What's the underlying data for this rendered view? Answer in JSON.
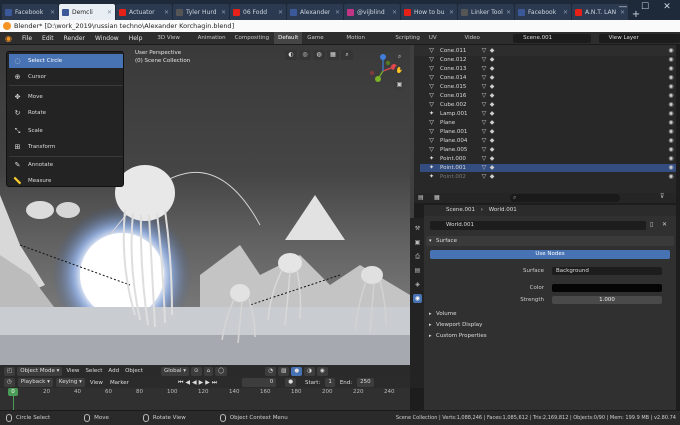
{
  "browser": {
    "tabs": [
      {
        "label": "Facebook",
        "color": "#3b5998",
        "active": false
      },
      {
        "label": "Demcli",
        "color": "#3b5998",
        "active": true
      },
      {
        "label": "Actuator",
        "color": "#e62117",
        "active": false
      },
      {
        "label": "Tyler Hurd",
        "color": "#555555",
        "active": false
      },
      {
        "label": "06 Fodd",
        "color": "#e62117",
        "active": false
      },
      {
        "label": "Alexander",
        "color": "#3b5998",
        "active": false
      },
      {
        "label": "@vijblind",
        "color": "#c13584",
        "active": false
      },
      {
        "label": "How to bu",
        "color": "#e62117",
        "active": false
      },
      {
        "label": "Linker Tools",
        "color": "#555555",
        "active": false
      },
      {
        "label": "Facebook",
        "color": "#3b5998",
        "active": false
      },
      {
        "label": "A.N.T. LAN",
        "color": "#e62117",
        "active": false
      }
    ],
    "new_tab": "+",
    "minimize": "—",
    "maximize": "☐",
    "close": "✕"
  },
  "window_title": "Blender* [D:\\work_2019\\russian techno\\Alexander Korchagin.blend]",
  "menu": [
    "File",
    "Edit",
    "Render",
    "Window",
    "Help"
  ],
  "workspaces": [
    "3D View Full",
    "Animation",
    "Compositing",
    "Default",
    "Game Logic",
    "Motion Tracking",
    "Scripting",
    "UV Editing",
    "Video Editing"
  ],
  "active_workspace": "Default",
  "scene_name": "Scene.001",
  "view_layer": "View Layer",
  "viewport": {
    "perspective": "User Perspective",
    "collection": "(0) Scene Collection"
  },
  "tools": [
    {
      "label": "Select Circle",
      "icon": "◌",
      "active": true
    },
    {
      "label": "Cursor",
      "icon": "⊕",
      "active": false
    },
    {
      "label": "Move",
      "icon": "✥",
      "active": false
    },
    {
      "label": "Rotate",
      "icon": "↻",
      "active": false
    },
    {
      "label": "Scale",
      "icon": "⤡",
      "active": false
    },
    {
      "label": "Transform",
      "icon": "⊞",
      "active": false
    },
    {
      "label": "Annotate",
      "icon": "✎",
      "active": false
    },
    {
      "label": "Measure",
      "icon": "📏",
      "active": false
    }
  ],
  "gizmo": {
    "x": "X",
    "y": "Y",
    "z": "Z"
  },
  "vp_header": {
    "mode": "Object Mode",
    "view": "View",
    "select": "Select",
    "add": "Add",
    "object": "Object",
    "orientation": "Global"
  },
  "timeline": {
    "playback": "Playback",
    "keying": "Keying",
    "view": "View",
    "marker": "Marker",
    "current": "0",
    "start_label": "Start:",
    "start": "1",
    "end_label": "End:",
    "end": "250",
    "ticks": [
      "0",
      "20",
      "40",
      "60",
      "80",
      "100",
      "120",
      "140",
      "160",
      "180",
      "200",
      "220",
      "240"
    ]
  },
  "outliner": {
    "rows": [
      {
        "name": "Cone.011",
        "icon": "▽",
        "sel": false,
        "dim": false
      },
      {
        "name": "Cone.012",
        "icon": "▽",
        "sel": false,
        "dim": false
      },
      {
        "name": "Cone.013",
        "icon": "▽",
        "sel": false,
        "dim": false
      },
      {
        "name": "Cone.014",
        "icon": "▽",
        "sel": false,
        "dim": false
      },
      {
        "name": "Cone.015",
        "icon": "▽",
        "sel": false,
        "dim": false
      },
      {
        "name": "Cone.016",
        "icon": "▽",
        "sel": false,
        "dim": false
      },
      {
        "name": "Cube.002",
        "icon": "▽",
        "sel": false,
        "dim": false
      },
      {
        "name": "Lamp.001",
        "icon": "✦",
        "sel": false,
        "dim": false
      },
      {
        "name": "Plane",
        "icon": "▽",
        "sel": false,
        "dim": false
      },
      {
        "name": "Plane.001",
        "icon": "▽",
        "sel": false,
        "dim": false
      },
      {
        "name": "Plane.004",
        "icon": "▽",
        "sel": false,
        "dim": false
      },
      {
        "name": "Plane.005",
        "icon": "▽",
        "sel": false,
        "dim": false
      },
      {
        "name": "Point.000",
        "icon": "✦",
        "sel": false,
        "dim": false
      },
      {
        "name": "Point.001",
        "icon": "✦",
        "sel": true,
        "dim": false
      },
      {
        "name": "Point.002",
        "icon": "✦",
        "sel": false,
        "dim": true
      }
    ]
  },
  "properties": {
    "breadcrumb_scene": "Scene.001",
    "breadcrumb_world": "World.001",
    "world": "World.001",
    "surface_panel": "Surface",
    "use_nodes": "Use Nodes",
    "surface_label": "Surface",
    "surface_value": "Background",
    "color_label": "Color",
    "strength_label": "Strength",
    "strength_value": "1.000",
    "volume_panel": "Volume",
    "viewport_display_panel": "Viewport Display",
    "custom_props_panel": "Custom Properties"
  },
  "status": {
    "circle_select": "Circle Select",
    "move": "Move",
    "rotate_view": "Rotate View",
    "context_menu": "Object Context Menu",
    "stats": "Scene Collection | Verts:1,088,246 | Faces:1,085,612 | Tris:2,169,812 | Objects:0/90 | Mem: 199.9 MB | v2.80.74"
  }
}
